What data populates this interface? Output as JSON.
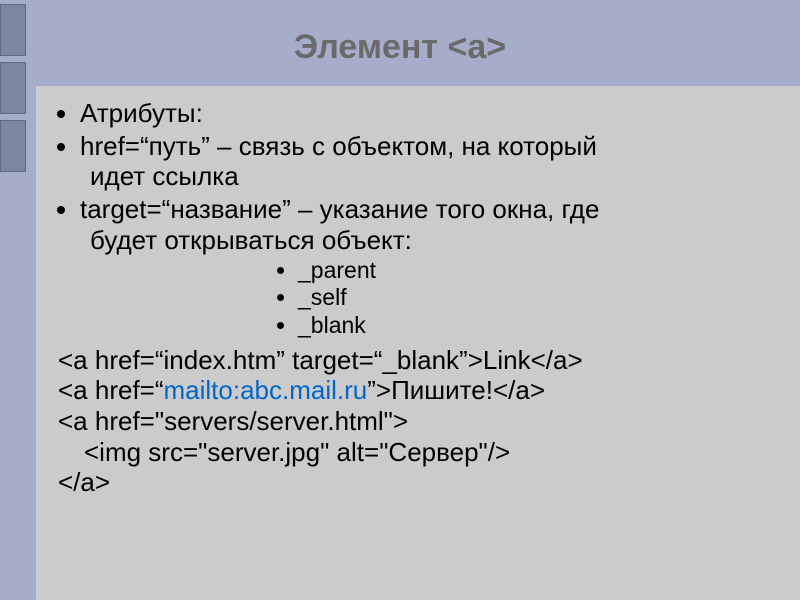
{
  "title": "Элемент <a>",
  "bullets": [
    "Атрибуты:",
    "href=“путь” – связь с объектом, на который",
    "target=“название” – указание того окна, где"
  ],
  "bullet1_cont": "идет ссылка",
  "bullet2_cont": "будет открываться объект:",
  "sub": [
    "_parent",
    "_self",
    "_blank"
  ],
  "code": {
    "l1": "<a href=“index.htm” target=“_blank”>Link</a>",
    "l2a": "<a href=“",
    "l2link": "mailto:abc.mail.ru",
    "l2b": "”>Пишите!</a>",
    "l3": "<a href=\"servers/server.html\">",
    "l4": "<img src=\"server.jpg\" alt=\"Сервер\"/>",
    "l5": "</a>"
  }
}
